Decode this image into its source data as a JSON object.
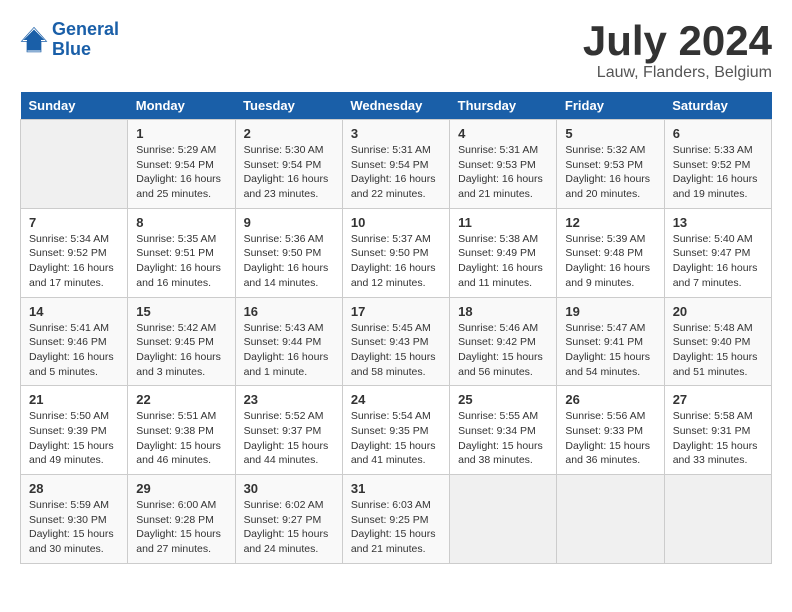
{
  "header": {
    "logo_line1": "General",
    "logo_line2": "Blue",
    "month_year": "July 2024",
    "location": "Lauw, Flanders, Belgium"
  },
  "weekdays": [
    "Sunday",
    "Monday",
    "Tuesday",
    "Wednesday",
    "Thursday",
    "Friday",
    "Saturday"
  ],
  "weeks": [
    [
      {
        "day": "",
        "content": ""
      },
      {
        "day": "1",
        "content": "Sunrise: 5:29 AM\nSunset: 9:54 PM\nDaylight: 16 hours\nand 25 minutes."
      },
      {
        "day": "2",
        "content": "Sunrise: 5:30 AM\nSunset: 9:54 PM\nDaylight: 16 hours\nand 23 minutes."
      },
      {
        "day": "3",
        "content": "Sunrise: 5:31 AM\nSunset: 9:54 PM\nDaylight: 16 hours\nand 22 minutes."
      },
      {
        "day": "4",
        "content": "Sunrise: 5:31 AM\nSunset: 9:53 PM\nDaylight: 16 hours\nand 21 minutes."
      },
      {
        "day": "5",
        "content": "Sunrise: 5:32 AM\nSunset: 9:53 PM\nDaylight: 16 hours\nand 20 minutes."
      },
      {
        "day": "6",
        "content": "Sunrise: 5:33 AM\nSunset: 9:52 PM\nDaylight: 16 hours\nand 19 minutes."
      }
    ],
    [
      {
        "day": "7",
        "content": "Sunrise: 5:34 AM\nSunset: 9:52 PM\nDaylight: 16 hours\nand 17 minutes."
      },
      {
        "day": "8",
        "content": "Sunrise: 5:35 AM\nSunset: 9:51 PM\nDaylight: 16 hours\nand 16 minutes."
      },
      {
        "day": "9",
        "content": "Sunrise: 5:36 AM\nSunset: 9:50 PM\nDaylight: 16 hours\nand 14 minutes."
      },
      {
        "day": "10",
        "content": "Sunrise: 5:37 AM\nSunset: 9:50 PM\nDaylight: 16 hours\nand 12 minutes."
      },
      {
        "day": "11",
        "content": "Sunrise: 5:38 AM\nSunset: 9:49 PM\nDaylight: 16 hours\nand 11 minutes."
      },
      {
        "day": "12",
        "content": "Sunrise: 5:39 AM\nSunset: 9:48 PM\nDaylight: 16 hours\nand 9 minutes."
      },
      {
        "day": "13",
        "content": "Sunrise: 5:40 AM\nSunset: 9:47 PM\nDaylight: 16 hours\nand 7 minutes."
      }
    ],
    [
      {
        "day": "14",
        "content": "Sunrise: 5:41 AM\nSunset: 9:46 PM\nDaylight: 16 hours\nand 5 minutes."
      },
      {
        "day": "15",
        "content": "Sunrise: 5:42 AM\nSunset: 9:45 PM\nDaylight: 16 hours\nand 3 minutes."
      },
      {
        "day": "16",
        "content": "Sunrise: 5:43 AM\nSunset: 9:44 PM\nDaylight: 16 hours\nand 1 minute."
      },
      {
        "day": "17",
        "content": "Sunrise: 5:45 AM\nSunset: 9:43 PM\nDaylight: 15 hours\nand 58 minutes."
      },
      {
        "day": "18",
        "content": "Sunrise: 5:46 AM\nSunset: 9:42 PM\nDaylight: 15 hours\nand 56 minutes."
      },
      {
        "day": "19",
        "content": "Sunrise: 5:47 AM\nSunset: 9:41 PM\nDaylight: 15 hours\nand 54 minutes."
      },
      {
        "day": "20",
        "content": "Sunrise: 5:48 AM\nSunset: 9:40 PM\nDaylight: 15 hours\nand 51 minutes."
      }
    ],
    [
      {
        "day": "21",
        "content": "Sunrise: 5:50 AM\nSunset: 9:39 PM\nDaylight: 15 hours\nand 49 minutes."
      },
      {
        "day": "22",
        "content": "Sunrise: 5:51 AM\nSunset: 9:38 PM\nDaylight: 15 hours\nand 46 minutes."
      },
      {
        "day": "23",
        "content": "Sunrise: 5:52 AM\nSunset: 9:37 PM\nDaylight: 15 hours\nand 44 minutes."
      },
      {
        "day": "24",
        "content": "Sunrise: 5:54 AM\nSunset: 9:35 PM\nDaylight: 15 hours\nand 41 minutes."
      },
      {
        "day": "25",
        "content": "Sunrise: 5:55 AM\nSunset: 9:34 PM\nDaylight: 15 hours\nand 38 minutes."
      },
      {
        "day": "26",
        "content": "Sunrise: 5:56 AM\nSunset: 9:33 PM\nDaylight: 15 hours\nand 36 minutes."
      },
      {
        "day": "27",
        "content": "Sunrise: 5:58 AM\nSunset: 9:31 PM\nDaylight: 15 hours\nand 33 minutes."
      }
    ],
    [
      {
        "day": "28",
        "content": "Sunrise: 5:59 AM\nSunset: 9:30 PM\nDaylight: 15 hours\nand 30 minutes."
      },
      {
        "day": "29",
        "content": "Sunrise: 6:00 AM\nSunset: 9:28 PM\nDaylight: 15 hours\nand 27 minutes."
      },
      {
        "day": "30",
        "content": "Sunrise: 6:02 AM\nSunset: 9:27 PM\nDaylight: 15 hours\nand 24 minutes."
      },
      {
        "day": "31",
        "content": "Sunrise: 6:03 AM\nSunset: 9:25 PM\nDaylight: 15 hours\nand 21 minutes."
      },
      {
        "day": "",
        "content": ""
      },
      {
        "day": "",
        "content": ""
      },
      {
        "day": "",
        "content": ""
      }
    ]
  ]
}
